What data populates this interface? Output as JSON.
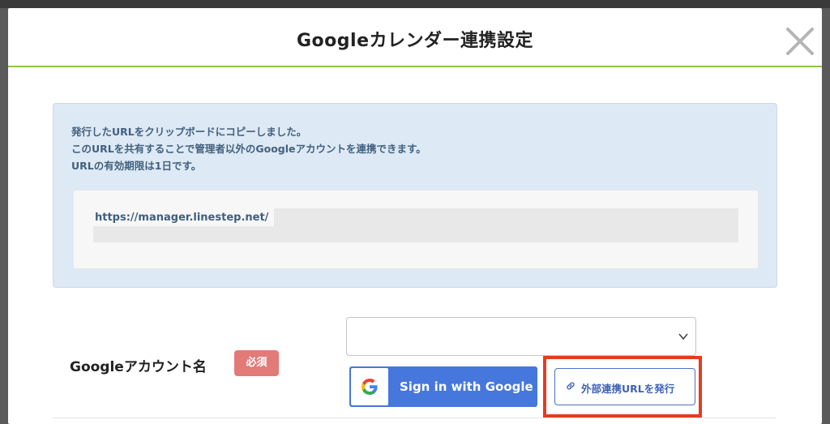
{
  "modal": {
    "title": "Googleカレンダー連携設定"
  },
  "info": {
    "lines": [
      "発行したURLをクリップボードにコピーしました。",
      "このURLを共有することで管理者以外のGoogleアカウントを連携できます。",
      "URLの有効期限は1日です。"
    ],
    "url_prefix": "https://manager.linestep.net/"
  },
  "form": {
    "account_label": "Googleアカウント名",
    "required_badge": "必須",
    "account_select_value": ""
  },
  "buttons": {
    "google_signin": "Sign in with Google",
    "external_url": "外部連携URLを発行"
  },
  "colors": {
    "accent_line": "#8cc63f",
    "google_blue": "#4577dd",
    "highlight": "#e53b22",
    "required": "#e27a78"
  }
}
